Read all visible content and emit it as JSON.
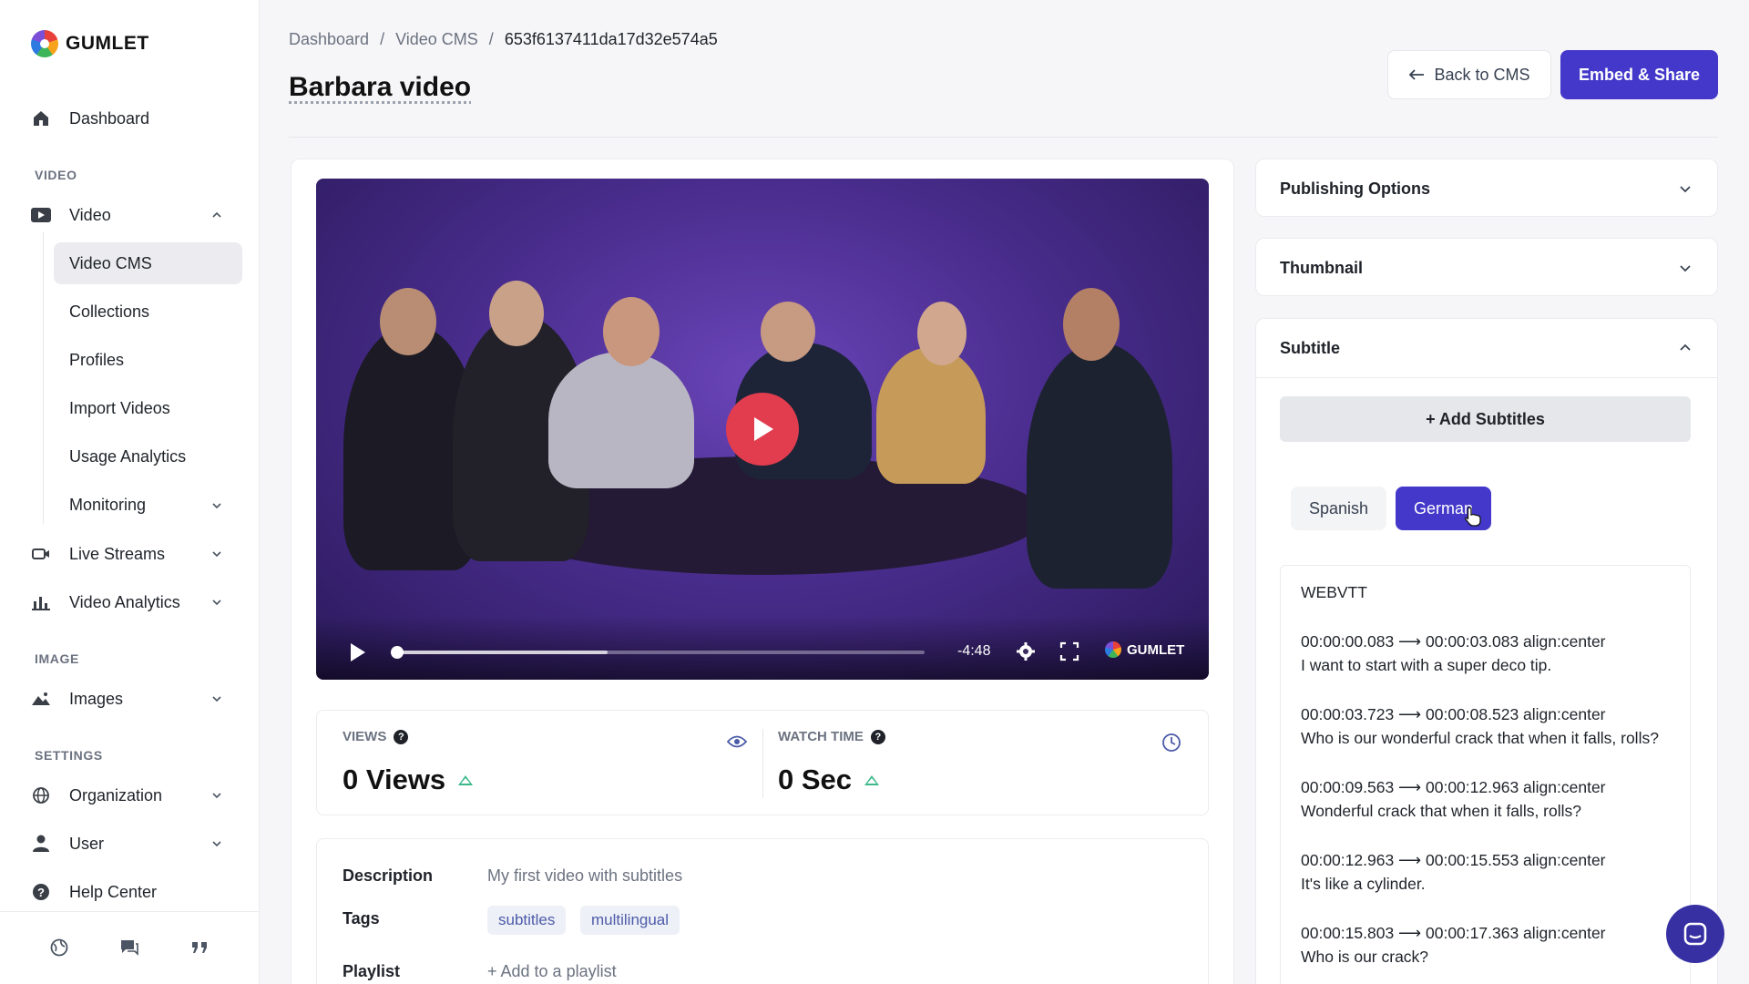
{
  "brand": {
    "name": "GUMLET"
  },
  "sidebar": {
    "dashboard": "Dashboard",
    "sections": {
      "video": "VIDEO",
      "image": "IMAGE",
      "settings": "SETTINGS"
    },
    "video": "Video",
    "video_sub": [
      "Video CMS",
      "Collections",
      "Profiles",
      "Import Videos",
      "Usage Analytics",
      "Monitoring"
    ],
    "live_streams": "Live Streams",
    "video_analytics": "Video Analytics",
    "images": "Images",
    "organization": "Organization",
    "user": "User",
    "help_center": "Help Center"
  },
  "breadcrumb": {
    "home": "Dashboard",
    "section": "Video CMS",
    "current": "653f6137411da17d32e574a5",
    "sep": "/"
  },
  "page": {
    "title": "Barbara video"
  },
  "actions": {
    "back": "Back to CMS",
    "embed": "Embed & Share"
  },
  "player": {
    "time_left": "-4:48",
    "brand": "GUMLET",
    "progress_played": 0.0,
    "progress_buffered": 0.4
  },
  "stats": {
    "views_label": "VIEWS",
    "views_value": "0 Views",
    "watch_label": "WATCH TIME",
    "watch_value": "0 Sec"
  },
  "details": {
    "description_label": "Description",
    "description": "My first video with subtitles",
    "tags_label": "Tags",
    "tags": [
      "subtitles",
      "multilingual"
    ],
    "playlist_label": "Playlist",
    "playlist_action": "+ Add to a playlist"
  },
  "panel": {
    "publishing": "Publishing Options",
    "thumbnail": "Thumbnail",
    "subtitle": "Subtitle",
    "add_subtitles": "+ Add Subtitles",
    "languages": [
      "Spanish",
      "German"
    ],
    "selected_language": "German"
  },
  "vtt": {
    "header": "WEBVTT",
    "cues": [
      {
        "time": "00:00:00.083 --> 00:00:03.083 align:center",
        "text": "I want to start with a super deco tip."
      },
      {
        "time": "00:00:03.723 --> 00:00:08.523 align:center",
        "text": "Who is our wonderful crack that when it falls, rolls?"
      },
      {
        "time": "00:00:09.563 --> 00:00:12.963 align:center",
        "text": "Wonderful crack that when it falls, rolls?"
      },
      {
        "time": "00:00:12.963 --> 00:00:15.553 align:center",
        "text": "It's like a cylinder."
      },
      {
        "time": "00:00:15.803 --> 00:00:17.363 align:center",
        "text": "Who is our crack?"
      }
    ]
  },
  "colors": {
    "accent": "#4338ca",
    "play": "#e23d4f",
    "trend": "#3cb88a"
  }
}
